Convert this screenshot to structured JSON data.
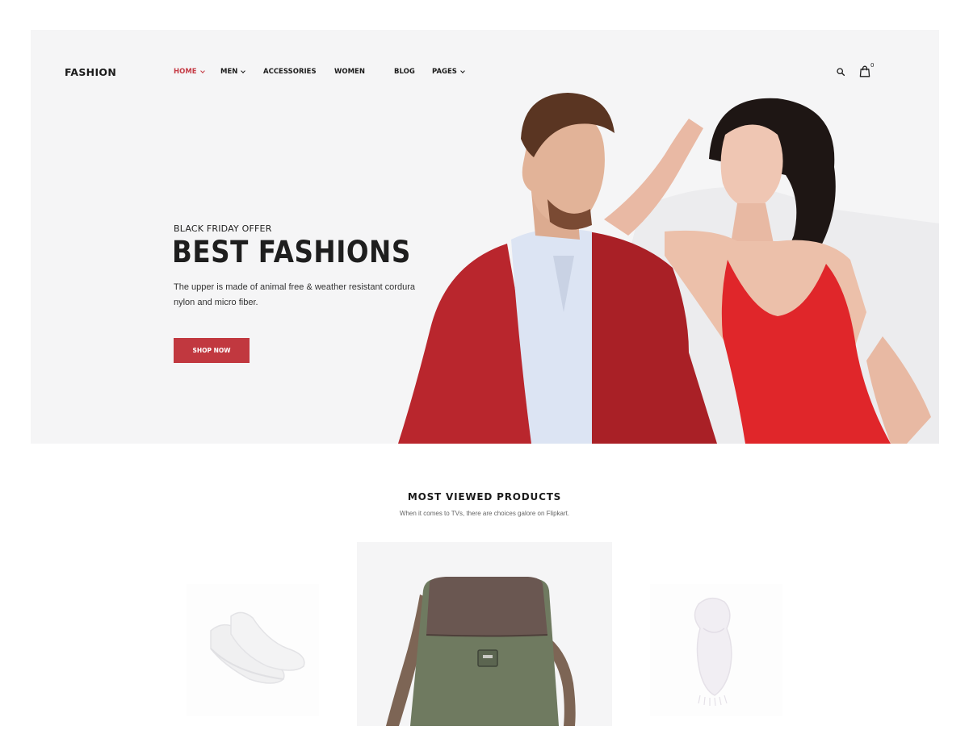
{
  "header": {
    "logo": "FASHION",
    "nav": [
      {
        "label": "HOME",
        "dropdown": true,
        "active": true
      },
      {
        "label": "MEN",
        "dropdown": true,
        "active": false
      },
      {
        "label": "ACCESSORIES",
        "dropdown": false,
        "active": false
      },
      {
        "label": "WOMEN",
        "dropdown": false,
        "active": false
      },
      {
        "label": "BLOG",
        "dropdown": false,
        "active": false
      },
      {
        "label": "PAGES",
        "dropdown": true,
        "active": false
      }
    ],
    "cart_count": "0",
    "icons": [
      "search-icon",
      "shopping-bag-icon"
    ]
  },
  "hero": {
    "eyebrow": "BLACK FRIDAY OFFER",
    "title": "BEST FASHIONS",
    "description": "The upper is made of animal free & weather resistant cordura nylon and micro fiber.",
    "button_label": "SHOP NOW",
    "image": "couple-in-red-outfits"
  },
  "products_section": {
    "title": "MOST VIEWED PRODUCTS",
    "subtitle": "When it comes to TVs, there are choices galore on Flipkart.",
    "products": [
      {
        "image": "white-sneakers"
      },
      {
        "image": "green-leather-messenger-bag"
      },
      {
        "image": "white-scarf"
      }
    ]
  },
  "colors": {
    "accent": "#c1383f",
    "hero_bg": "#f5f5f6",
    "text_dark": "#1b1b1b"
  }
}
